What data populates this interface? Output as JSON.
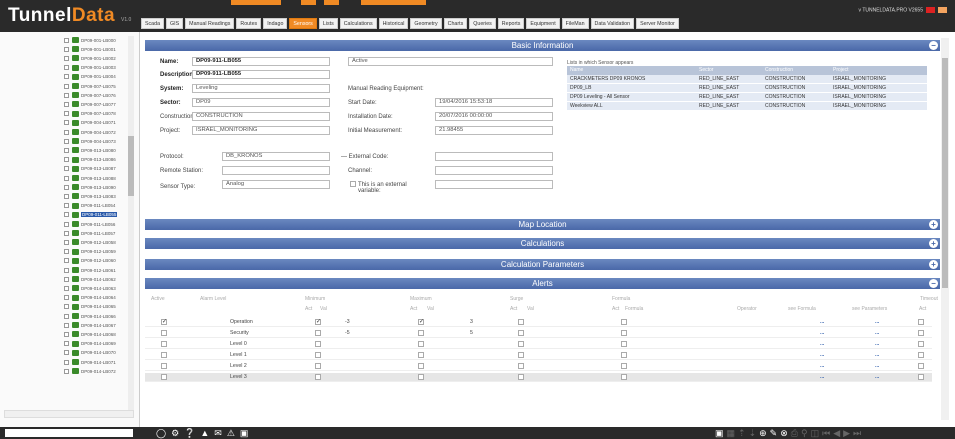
{
  "app": {
    "logo_part1": "Tunnel",
    "logo_part2": "Data",
    "logo_sub": "V1.0",
    "user_info": "v TUNNELDATA.PRO V2655"
  },
  "nav": [
    "Scada",
    "GIS",
    "Manual Readings",
    "Routes",
    "Indago",
    "Sensors",
    "Lists",
    "Calculations",
    "Historical",
    "Geometry",
    "Charts",
    "Queries",
    "Reports",
    "Equipment",
    "FileMan",
    "Data Validation",
    "Server Monitor"
  ],
  "nav_active": "Sensors",
  "tree": {
    "items": [
      "DP09-001-LB000",
      "DP09-001-LB001",
      "DP09-001-LB002",
      "DP09-001-LB003",
      "DP09-001-LB004",
      "DP09-007-LB075",
      "DP09-007-LB076",
      "DP09-007-LB077",
      "DP09-007-LB078",
      "DP09-004-LB071",
      "DP09-004-LB072",
      "DP09-004-LB073",
      "DP09-013-LB080",
      "DP09-013-LB086",
      "DP09-013-LB087",
      "DP09-013-LB088",
      "DP09-013-LB090",
      "DP09-013-LB083",
      "DP09-011-LB054",
      "DP09-011-LB055",
      "DP09-011-LB056",
      "DP09-011-LB057",
      "DP09-012-LB058",
      "DP09-012-LB059",
      "DP09-012-LB060",
      "DP09-012-LB061",
      "DP09-014-LB062",
      "DP09-014-LB063",
      "DP09-014-LB064",
      "DP09-014-LB065",
      "DP09-014-LB066",
      "DP09-014-LB067",
      "DP09-014-LB068",
      "DP09-014-LB069",
      "DP09-014-LB070",
      "DP09-014-LB071",
      "DP09-014-LB072"
    ],
    "selected": "DP09-011-LB055"
  },
  "basic": {
    "section_title": "Basic Information",
    "name_label": "Name:",
    "name_value": "DP09-911-LB055",
    "active_value": "Active",
    "desc_label": "Description:",
    "desc_value": "DP09-911-LB055",
    "system_label": "System:",
    "system_value": "Leveling",
    "manual_label": "Manual Reading Equipment:",
    "sector_label": "Sector:",
    "sector_value": "DP09",
    "start_label": "Start Date:",
    "start_value": "19/04/2016 15:53:18",
    "construction_label": "Construction:",
    "construction_value": "CONSTRUCTION",
    "install_label": "Installation Date:",
    "install_value": "20/07/2016 00:00:00",
    "project_label": "Project:",
    "project_value": "ISRAEL_MONITORING",
    "initial_label": "Initial Measurement:",
    "initial_value": "21.98455",
    "protocol_label": "Protocol:",
    "protocol_value": "DB_KRONOS",
    "external_code_label": "External Code:",
    "remote_label": "Remote Station:",
    "channel_label": "Channel:",
    "sensor_type_label": "Sensor Type:",
    "sensor_type_value": "Analog",
    "external_var_label": "This is an external variable:"
  },
  "lists": {
    "title": "Lists in which Sensor appears",
    "headers": [
      "Name",
      "Sector",
      "Construction",
      "Project"
    ],
    "rows": [
      [
        "CRACKMETERS DP09 KRONOS",
        "RED_LINE_EAST",
        "CONSTRUCTION",
        "ISRAEL_MONITORING"
      ],
      [
        "DP09_LB",
        "RED_LINE_EAST",
        "CONSTRUCTION",
        "ISRAEL_MONITORING"
      ],
      [
        "DP09 Leveling - All Sensor",
        "RED_LINE_EAST",
        "CONSTRUCTION",
        "ISRAEL_MONITORING"
      ],
      [
        "Weekview ALL",
        "RED_LINE_EAST",
        "CONSTRUCTION",
        "ISRAEL_MONITORING"
      ]
    ]
  },
  "sections": {
    "map": "Map Location",
    "calc": "Calculations",
    "calc_params": "Calculation Parameters",
    "alerts": "Alerts"
  },
  "alerts": {
    "headers_top": [
      "Active",
      "Alarm Level",
      "Minimum",
      "Maximum",
      "Surge",
      "Formula",
      "Timeout"
    ],
    "headers_sub": [
      "Act",
      "Val",
      "Act",
      "Val",
      "Act",
      "Val",
      "Act",
      "Formula",
      "Operator",
      "see Formula",
      "see Parameters",
      "Act"
    ],
    "rows": [
      {
        "active": true,
        "level": "Operation",
        "min_act": true,
        "min_val": "-3",
        "max_act": true,
        "max_val": "3"
      },
      {
        "active": false,
        "level": "Security",
        "min_act": false,
        "min_val": "-5",
        "max_act": false,
        "max_val": "5"
      },
      {
        "active": false,
        "level": "Level 0",
        "min_act": false,
        "min_val": "",
        "max_act": false,
        "max_val": ""
      },
      {
        "active": false,
        "level": "Level 1",
        "min_act": false,
        "min_val": "",
        "max_act": false,
        "max_val": ""
      },
      {
        "active": false,
        "level": "Level 2",
        "min_act": false,
        "min_val": "",
        "max_act": false,
        "max_val": ""
      },
      {
        "active": false,
        "level": "Level 3",
        "min_act": false,
        "min_val": "",
        "max_act": false,
        "max_val": ""
      }
    ]
  },
  "colors": {
    "accent": "#f08a24",
    "section": "#4a68a8",
    "topbar": "#2a2a2a"
  }
}
